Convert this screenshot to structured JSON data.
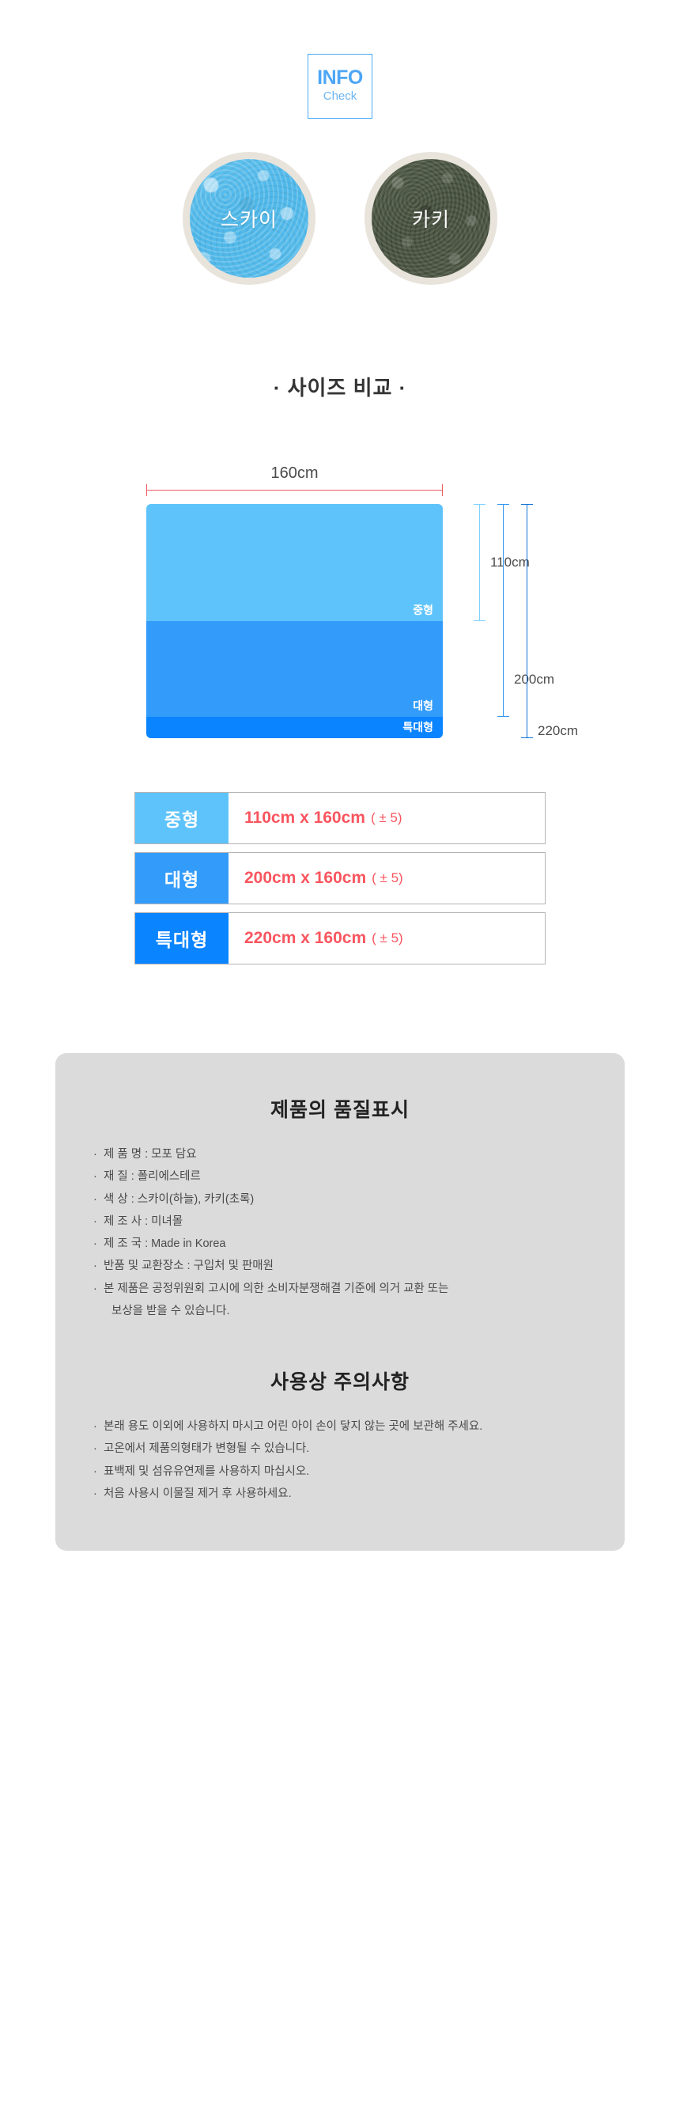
{
  "badge": {
    "title": "INFO",
    "subtitle": "Check"
  },
  "colors": {
    "items": [
      {
        "label": "스카이",
        "swatch": "#4fb8ea",
        "ring": "#e8e4dc"
      },
      {
        "label": "카키",
        "swatch": "#4a5442",
        "ring": "#e8e4dc"
      }
    ]
  },
  "size_section": {
    "heading": "· 사이즈 비교 ·",
    "width_label": "160cm",
    "bands": [
      {
        "label": "중형",
        "height_label": "110cm",
        "color": "#5ec3fb"
      },
      {
        "label": "대형",
        "height_label": "200cm",
        "color": "#339cfb"
      },
      {
        "label": "특대형",
        "height_label": "220cm",
        "color": "#0a84ff"
      }
    ],
    "dimension_labels": {
      "d110": "110cm",
      "d200": "200cm",
      "d220": "220cm"
    }
  },
  "size_table": {
    "rows": [
      {
        "key": "중형",
        "value": "110cm x 160cm",
        "tolerance": "( ± 5)",
        "key_color": "#5ec3fb"
      },
      {
        "key": "대형",
        "value": "200cm x 160cm",
        "tolerance": "( ± 5)",
        "key_color": "#339cfb"
      },
      {
        "key": "특대형",
        "value": "220cm x 160cm",
        "tolerance": "( ± 5)",
        "key_color": "#0a84ff"
      }
    ],
    "value_color": "#f9555f"
  },
  "quality": {
    "heading": "제품의 품질표시",
    "items": [
      "제 품 명 : 모포 담요",
      "재     질 : 폴리에스테르",
      "색     상 : 스카이(하늘), 카키(초록)",
      "제 조 사 : 미녀몰",
      "제 조 국 : Made in Korea",
      "반품 및 교환장소 : 구입처 및 판매원",
      "본 제품은 공정위원회 고시에 의한 소비자분쟁해결 기준에 의거 교환 또는",
      "보상을 받을 수 있습니다."
    ]
  },
  "caution": {
    "heading": "사용상 주의사항",
    "items": [
      "본래 용도 이외에 사용하지 마시고 어린 아이 손이 닿지 않는 곳에 보관해 주세요.",
      "고온에서 제품의형태가 변형될 수 있습니다.",
      "표백제 및 섬유유연제를 사용하지 마십시오.",
      "처음 사용시 이물질 제거 후 사용하세요."
    ]
  }
}
